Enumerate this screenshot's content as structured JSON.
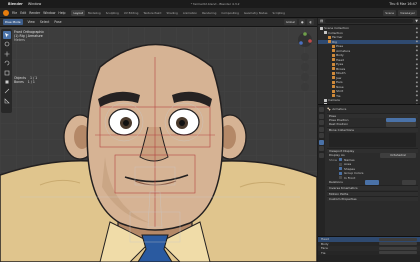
{
  "macos": {
    "app_name": "Blender",
    "menu": "Window",
    "clock": "Thu 6 Mar 16:47"
  },
  "window_title": "* farmer02.blend - Blender 4.3.2",
  "topbar": {
    "menus": [
      "File",
      "Edit",
      "Render",
      "Window",
      "Help"
    ],
    "workspaces": [
      "Layout",
      "Modeling",
      "Sculpting",
      "UV Editing",
      "Texture Paint",
      "Shading",
      "Animation",
      "Rendering",
      "Compositing",
      "Geometry Nodes",
      "Scripting"
    ],
    "active_workspace": "Layout",
    "scene": "Scene",
    "view_layer": "ViewLayer"
  },
  "viewport_header": {
    "mode": "Pose Mode",
    "menus": [
      "View",
      "Select",
      "Pose"
    ],
    "transform_orientation": "Global"
  },
  "viewport_overlay": {
    "line1": "Front Orthographic",
    "line2": "(1) Rig | Armature",
    "line3": "Meters",
    "stats": [
      {
        "label": "Objects",
        "value": "1 / 1"
      },
      {
        "label": "Bones",
        "value": "1 / 1"
      }
    ]
  },
  "outliner": {
    "items": [
      {
        "label": "Scene Collection",
        "indent": 0
      },
      {
        "label": "Collection",
        "indent": 1
      },
      {
        "label": "Farmer",
        "indent": 2
      },
      {
        "label": "Rig",
        "indent": 2
      },
      {
        "label": "Pose",
        "indent": 3
      },
      {
        "label": "Armature",
        "indent": 3
      },
      {
        "label": "Body",
        "indent": 3
      },
      {
        "label": "Head",
        "indent": 3
      },
      {
        "label": "Eyes",
        "indent": 3
      },
      {
        "label": "Brows",
        "indent": 3
      },
      {
        "label": "Mouth",
        "indent": 3
      },
      {
        "label": "Jaw",
        "indent": 3
      },
      {
        "label": "Ears",
        "indent": 3
      },
      {
        "label": "Nose",
        "indent": 3
      },
      {
        "label": "Shirt",
        "indent": 3
      },
      {
        "label": "Tie",
        "indent": 3
      },
      {
        "label": "Camera",
        "indent": 1
      },
      {
        "label": "Light",
        "indent": 1
      }
    ],
    "selected_index": 3
  },
  "properties": {
    "header": "Armature",
    "sections": {
      "pose": "Pose",
      "bone_collections": "Bone Collections",
      "rest_position": "Rest Position",
      "display": "Viewport Display",
      "inverse_kinematics": "Inverse Kinematics",
      "motion_paths": "Motion Paths",
      "custom_properties": "Custom Properties"
    },
    "fields": {
      "pose_position": "Pose Position",
      "rest_position": "Rest Position",
      "display_as": "Display As",
      "display_value": "Octahedral",
      "show": "Show",
      "names": "Names",
      "axes": "Axes",
      "shapes": "Shapes",
      "group_colors": "Group Colors",
      "in_front": "In Front",
      "relations": "Relations"
    }
  },
  "bottom_panel": {
    "rows": [
      "Head",
      "Body",
      "Face",
      "Tie"
    ]
  },
  "colors": {
    "skin": "#d6b394",
    "skin_shadow": "#b48867",
    "shirt": "#e0c58d",
    "tie": "#2a5aa0",
    "accent": "#4a72a8",
    "brow": "#262222"
  }
}
